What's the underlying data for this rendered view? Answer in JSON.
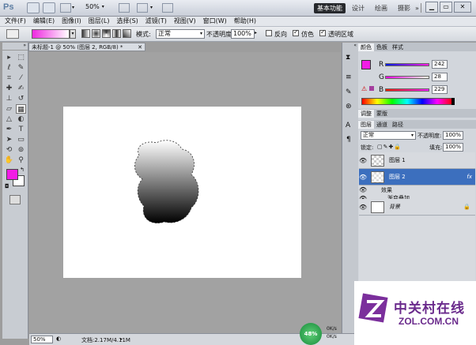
{
  "appbar": {
    "logo": "Ps",
    "zoom": "50%",
    "workspaces": [
      "基本功能",
      "设计",
      "绘画",
      "摄影"
    ],
    "more": "»"
  },
  "menu": [
    "文件(F)",
    "编辑(E)",
    "图像(I)",
    "图层(L)",
    "选择(S)",
    "滤镜(T)",
    "视图(V)",
    "窗口(W)",
    "帮助(H)"
  ],
  "options": {
    "mode_label": "模式:",
    "mode_value": "正常",
    "opacity_label": "不透明度:",
    "opacity_value": "100%",
    "reverse_label": "反向",
    "dither_label": "仿色",
    "transparency_label": "透明区域"
  },
  "document": {
    "tab_title": "未标题-1 @ 50% (图层 2, RGB/8) *"
  },
  "color_panel": {
    "tabs": [
      "颜色",
      "色板",
      "样式"
    ],
    "channels": [
      {
        "label": "R",
        "value": "242"
      },
      {
        "label": "G",
        "value": "28"
      },
      {
        "label": "B",
        "value": "229"
      }
    ],
    "foreground": "#f21ce5"
  },
  "adjust_tabs": [
    "调整",
    "蒙版"
  ],
  "layers_panel": {
    "tabs": [
      "图层",
      "通道",
      "路径"
    ],
    "blend_mode": "正常",
    "opacity_label": "不透明度:",
    "opacity_value": "100%",
    "lock_label": "锁定:",
    "fill_label": "填充:",
    "fill_value": "100%",
    "layers": [
      {
        "name": "图层 1",
        "selected": false
      },
      {
        "name": "图层 2",
        "selected": true,
        "fx": "fx"
      },
      {
        "name": "效果",
        "sub": true
      },
      {
        "name": "渐变叠加",
        "sub": true
      },
      {
        "name": "背景",
        "locked": true
      }
    ]
  },
  "status": {
    "zoom": "50%",
    "doc_info": "文档:2.17M/4.11M",
    "progress": "48%",
    "rate1": "0K/s",
    "rate2": "0K/s"
  },
  "watermark": {
    "brand": "中关村在线",
    "url": "ZOL.COM.CN"
  }
}
